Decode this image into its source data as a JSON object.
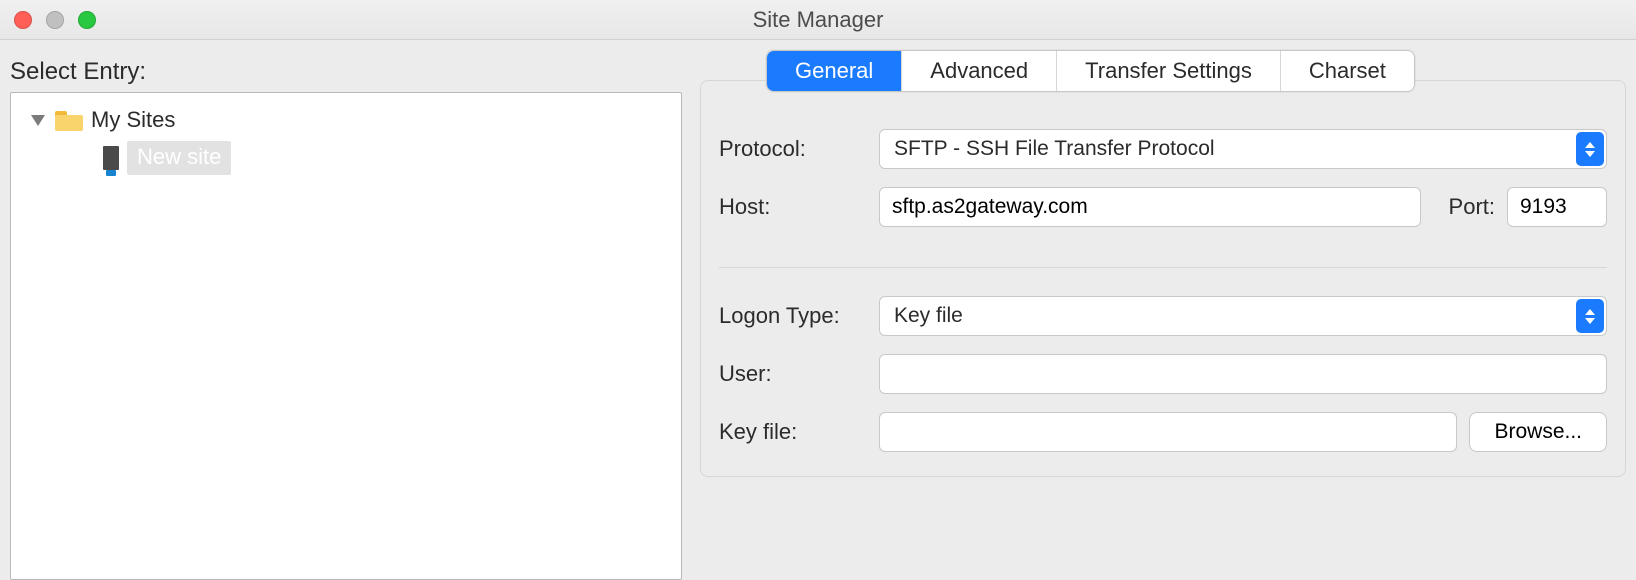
{
  "window": {
    "title": "Site Manager"
  },
  "left": {
    "select_entry_label": "Select Entry:",
    "root_label": "My Sites",
    "new_site_label": "New site"
  },
  "tabs": {
    "general": "General",
    "advanced": "Advanced",
    "transfer": "Transfer Settings",
    "charset": "Charset"
  },
  "labels": {
    "protocol": "Protocol:",
    "host": "Host:",
    "port": "Port:",
    "logon_type": "Logon Type:",
    "user": "User:",
    "key_file": "Key file:",
    "browse": "Browse..."
  },
  "values": {
    "protocol": "SFTP - SSH File Transfer Protocol",
    "host": "sftp.as2gateway.com",
    "port": "9193",
    "logon_type": "Key file",
    "user": "",
    "key_file": ""
  }
}
